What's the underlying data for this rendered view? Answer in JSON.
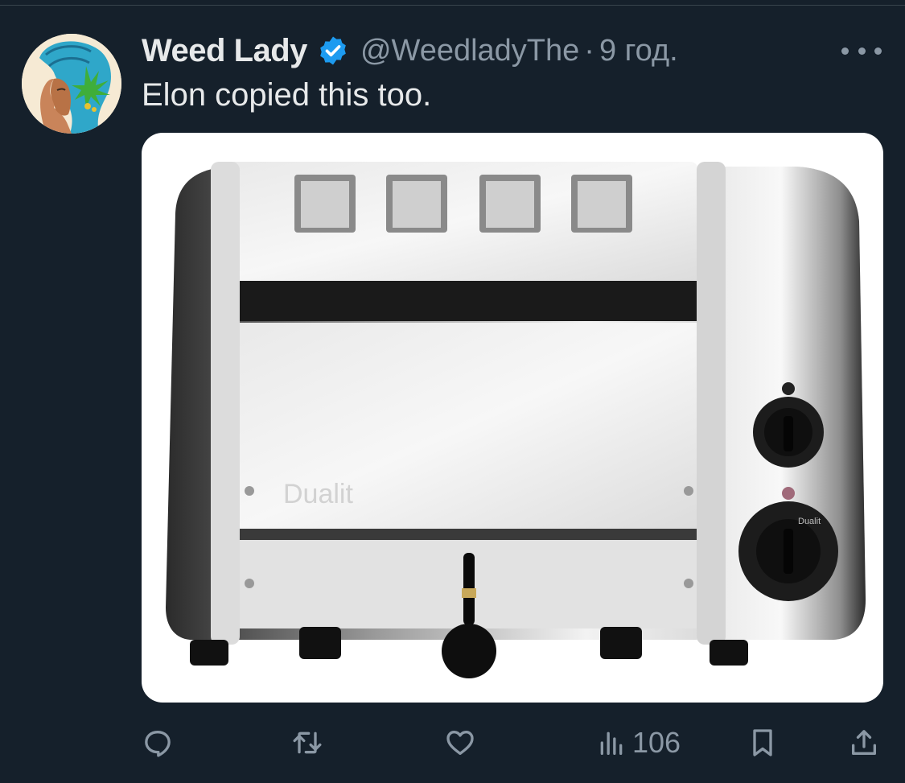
{
  "tweet": {
    "author_name": "Weed Lady",
    "author_handle": "@WeedladyThe",
    "separator": "·",
    "timestamp": "9 год.",
    "text": "Elon copied this too.",
    "media": {
      "brand_text": "Dualit",
      "dial_brand_text": "Dualit"
    }
  },
  "actions": {
    "reply": {
      "icon": "reply-icon"
    },
    "retweet": {
      "icon": "retweet-icon"
    },
    "like": {
      "icon": "heart-icon"
    },
    "views": {
      "icon": "views-icon",
      "count": "106"
    },
    "bookmark": {
      "icon": "bookmark-icon"
    },
    "share": {
      "icon": "share-icon"
    }
  },
  "colors": {
    "background": "#15202b",
    "primary_text": "#e7e9ea",
    "secondary_text": "#8b98a5",
    "verified": "#1d9bf0"
  }
}
